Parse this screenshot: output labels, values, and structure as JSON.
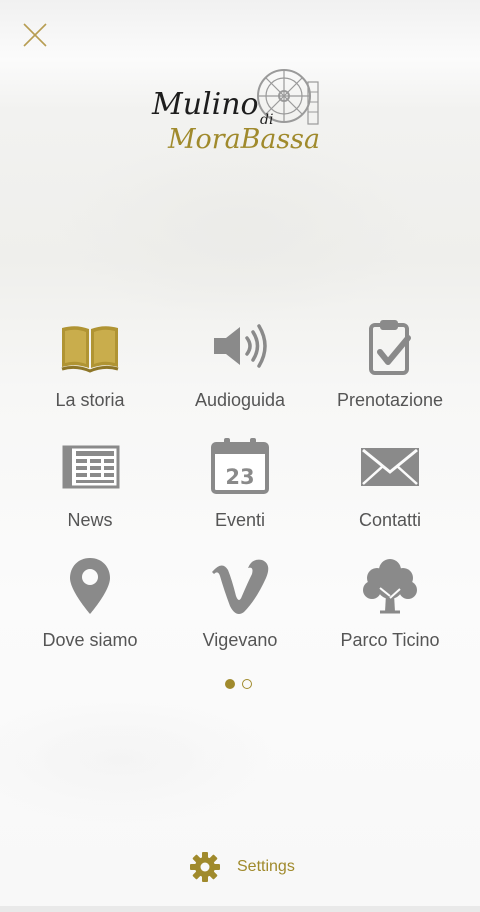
{
  "colors": {
    "accent_gold": "#a08a2c",
    "icon_gray": "#8a8a8a",
    "label_gray": "#555555"
  },
  "close_button": {
    "icon": "close-icon"
  },
  "logo": {
    "line1": "Mulino",
    "small": "di",
    "line2": "MoraBassa"
  },
  "menu": {
    "items": [
      {
        "label": "La storia",
        "icon": "book-icon"
      },
      {
        "label": "Audioguida",
        "icon": "speaker-icon"
      },
      {
        "label": "Prenotazione",
        "icon": "clipboard-check-icon"
      },
      {
        "label": "News",
        "icon": "newspaper-icon"
      },
      {
        "label": "Eventi",
        "icon": "calendar-icon",
        "badge": "23"
      },
      {
        "label": "Contatti",
        "icon": "envelope-icon"
      },
      {
        "label": "Dove siamo",
        "icon": "map-pin-icon"
      },
      {
        "label": "Vigevano",
        "icon": "vimeo-icon"
      },
      {
        "label": "Parco Ticino",
        "icon": "tree-icon"
      }
    ]
  },
  "pagination": {
    "pages": 2,
    "current": 1
  },
  "settings": {
    "label": "Settings",
    "icon": "gear-icon"
  }
}
